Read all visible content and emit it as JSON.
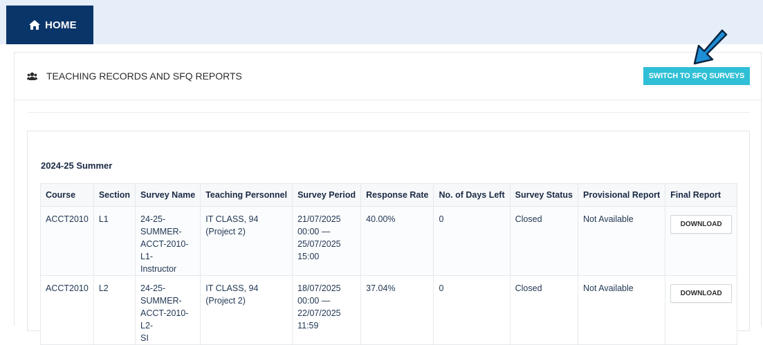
{
  "nav": {
    "home_label": "HOME",
    "home_icon": "home-icon"
  },
  "panel": {
    "title": "TEACHING RECORDS AND SFQ REPORTS",
    "title_icon": "users-icon",
    "switch_button_label": "SWITCH TO SFQ SURVEYS"
  },
  "term": "2024-25 Summer",
  "table": {
    "headers": {
      "course": "Course",
      "section": "Section",
      "survey_name": "Survey Name",
      "teaching_personnel": "Teaching Personnel",
      "survey_period": "Survey Period",
      "response_rate": "Response Rate",
      "days_left": "No. of Days Left",
      "survey_status": "Survey Status",
      "provisional_report": "Provisional Report",
      "final_report": "Final Report"
    },
    "rows": [
      {
        "course": "ACCT2010",
        "section": "L1",
        "survey_name": "24-25-SUMMER-ACCT-2010-L1-Instructor",
        "teaching_personnel": "IT CLASS, 94 (Project 2)",
        "survey_period": "21/07/2025 00:00 — 25/07/2025 15:00",
        "response_rate": "40.00%",
        "days_left": "0",
        "survey_status": "Closed",
        "provisional_report": "Not Available",
        "final_report": "DOWNLOAD"
      },
      {
        "course": "ACCT2010",
        "section": "L2",
        "survey_name": "24-25-SUMMER-ACCT-2010-L2-SI",
        "teaching_personnel": "IT CLASS, 94 (Project 2)",
        "survey_period": "18/07/2025 00:00 — 22/07/2025 11:59",
        "response_rate": "37.04%",
        "days_left": "0",
        "survey_status": "Closed",
        "provisional_report": "Not Available",
        "final_report": "DOWNLOAD"
      }
    ]
  },
  "colors": {
    "nav_bg": "#0a3568",
    "topbar_bg": "#e6eefa",
    "switch_button_bg": "#2fbfd6",
    "annotation_arrow": "#1e8fd6"
  }
}
